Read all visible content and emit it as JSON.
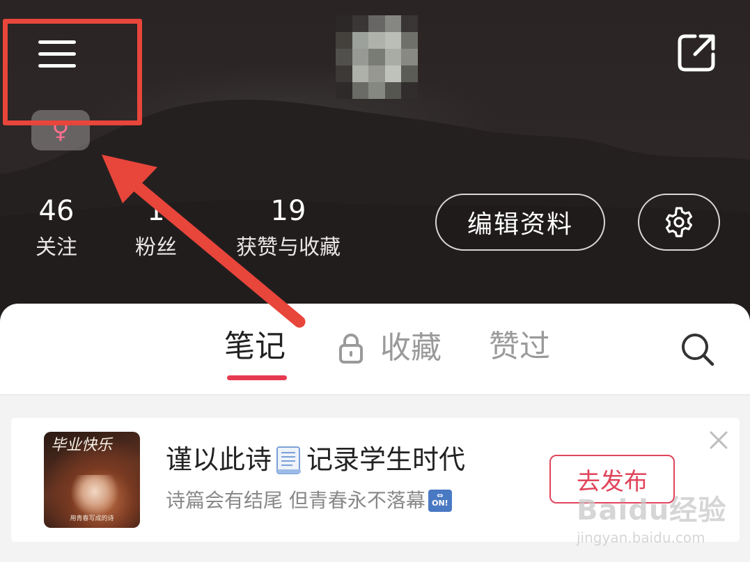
{
  "header": {
    "gender_symbol": "♀",
    "stats": [
      {
        "value": "46",
        "label": "关注"
      },
      {
        "value": "1",
        "label": "粉丝"
      },
      {
        "value": "19",
        "label": "获赞与收藏"
      }
    ],
    "edit_profile_label": "编辑资料",
    "icons": [
      "menu-icon",
      "share-icon",
      "gear-icon"
    ]
  },
  "tabs": {
    "items": [
      {
        "label": "笔记",
        "active": true
      },
      {
        "label": "收藏",
        "locked": true
      },
      {
        "label": "赞过"
      }
    ],
    "accent_color": "#e63a51"
  },
  "promo": {
    "thumbnail_title": "毕业快乐",
    "thumbnail_caption": "用青春写成的诗",
    "title_part1": "谨以此诗",
    "title_part2": "记录学生时代",
    "subtitle": "诗篇会有结尾 但青春永不落幕",
    "subtitle_icon_text": "ON!",
    "publish_label": "去发布"
  },
  "watermark": {
    "brand": "Baidu经验",
    "url": "jingyan.baidu.com"
  },
  "colors": {
    "header_bg": "#2b2525",
    "highlight_red": "#e8453b",
    "publish_red": "#e0455b"
  }
}
